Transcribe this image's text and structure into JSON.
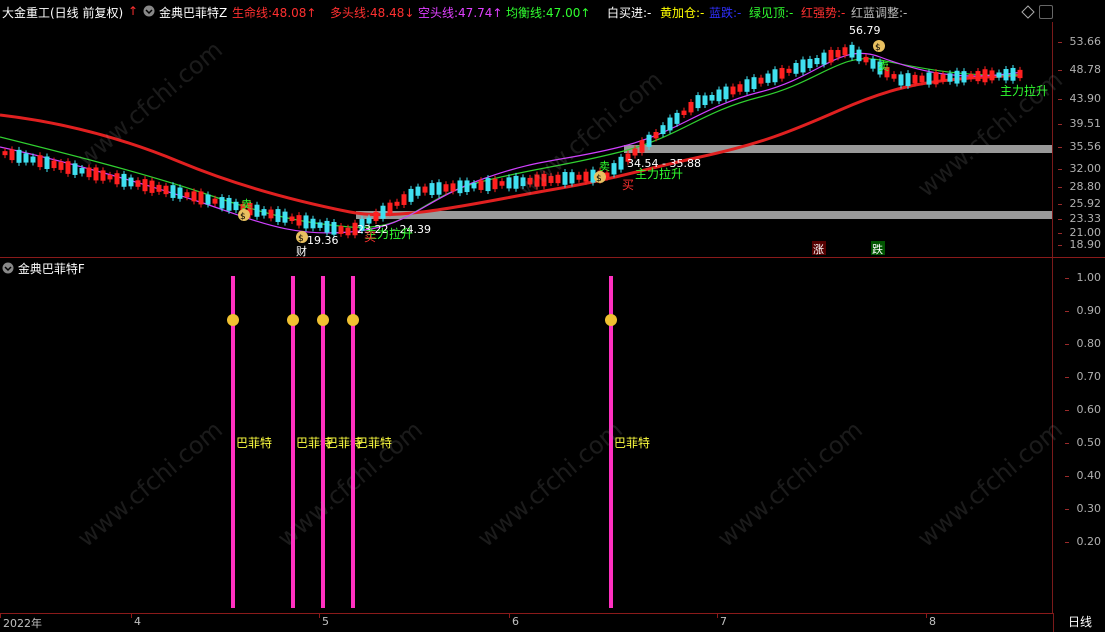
{
  "header": {
    "stock_name": "大金重工",
    "period_label": "(日线 前复权)",
    "indicator_name": "金典巴菲特Z",
    "lines": [
      {
        "label": "生命线",
        "value": "48.08",
        "arrow": "up",
        "color": "#ff3030"
      },
      {
        "label": "多头线",
        "value": "48.48",
        "arrow": "down",
        "color": "#ff3030"
      },
      {
        "label": "空头线",
        "value": "47.74",
        "arrow": "up",
        "color": "#e040ff"
      },
      {
        "label": "均衡线",
        "value": "47.00",
        "arrow": "up",
        "color": "#30ff30"
      }
    ],
    "status_items": [
      {
        "label": "白买进",
        "value": "-",
        "color": "#ffffff"
      },
      {
        "label": "黄加仓",
        "value": "-",
        "color": "#ffff00"
      },
      {
        "label": "蓝跌",
        "value": "-",
        "color": "#3030ff"
      },
      {
        "label": "绿见顶",
        "value": "-",
        "color": "#30ff30"
      },
      {
        "label": "红强势",
        "value": "-",
        "color": "#ff3030"
      },
      {
        "label": "红蓝调整",
        "value": "-",
        "color": "#bbbbbb"
      }
    ]
  },
  "main_axis": [
    "53.66",
    "48.78",
    "43.90",
    "39.51",
    "35.56",
    "32.00",
    "28.80",
    "25.92",
    "23.33",
    "21.00",
    "18.90"
  ],
  "sub_axis": [
    "1.00",
    "0.90",
    "0.80",
    "0.70",
    "0.60",
    "0.50",
    "0.40",
    "0.30",
    "0.20"
  ],
  "sub_panel": {
    "title": "金典巴菲特F",
    "signal_label": "巴菲特"
  },
  "annotations": {
    "high_price": "56.79",
    "low_price": "19.36",
    "zone1": "23.22 - 24.39",
    "zone2": "34.54 - 35.88",
    "rally_label": "主力拉升",
    "buy_label": "买",
    "sell_label": "卖",
    "cai_label": "财",
    "up_label": "涨",
    "down_label": "跌"
  },
  "x_axis": [
    "2022年",
    "4",
    "5",
    "6",
    "7",
    "8"
  ],
  "period_button": "日线",
  "colors": {
    "up": "#ff2020",
    "down": "#40e0f0",
    "ma_red": "#e02020",
    "ma_green": "#30d030",
    "ma_purple": "#d040ff",
    "signal": "#ff30c0"
  }
}
